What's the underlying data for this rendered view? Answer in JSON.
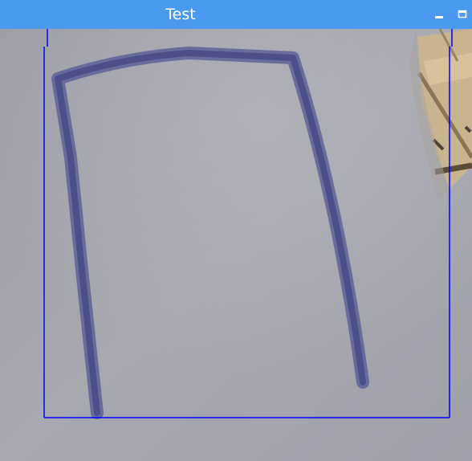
{
  "window": {
    "title": "Test"
  },
  "colors": {
    "titlebar": "#4a9af0",
    "detection_box": "#0000ff",
    "marker_stroke": "#4e5390",
    "paper": "#a3a4ac"
  },
  "icons": {
    "minimize": "minimize-icon",
    "maximize": "maximize-icon"
  }
}
